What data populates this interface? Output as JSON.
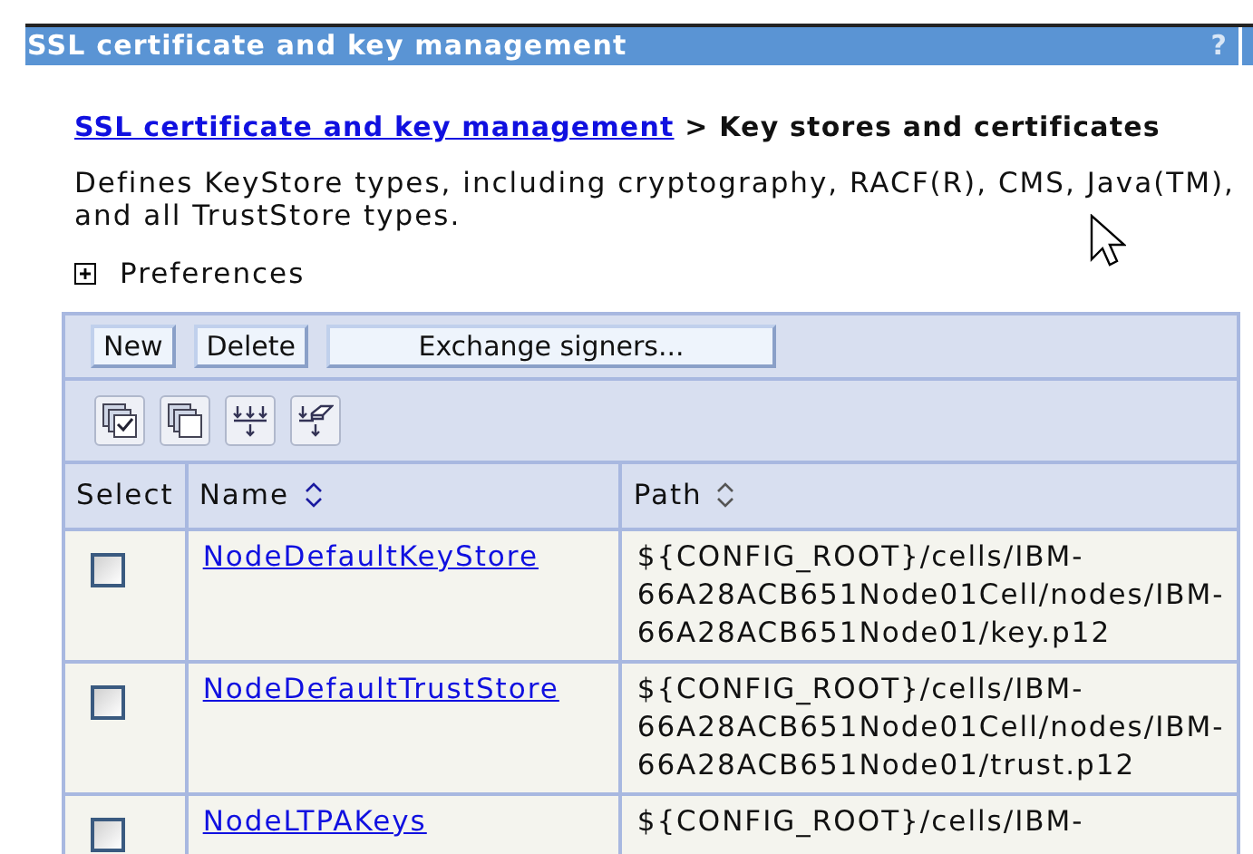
{
  "window": {
    "title": "SSL certificate and key management",
    "help": "?"
  },
  "breadcrumb": {
    "link": "SSL certificate and key management",
    "separator": ">",
    "current": "Key stores and certificates"
  },
  "description": "Defines KeyStore types, including cryptography, RACF(R), CMS, Java(TM), and all TrustStore types.",
  "preferences": {
    "label": "Preferences",
    "expanded": false
  },
  "buttons": [
    "New",
    "Delete",
    "Exchange signers..."
  ],
  "table": {
    "columns": [
      {
        "label": "Select",
        "sortable": false
      },
      {
        "label": "Name",
        "sortable": true
      },
      {
        "label": "Path",
        "sortable": true
      }
    ],
    "rows": [
      {
        "checked": false,
        "name": "NodeDefaultKeyStore",
        "path_lines": [
          "${CONFIG_ROOT}/cells/IBM-",
          "66A28ACB651Node01Cell/nodes/IBM-",
          "66A28ACB651Node01/key.p12"
        ]
      },
      {
        "checked": false,
        "name": "NodeDefaultTrustStore",
        "path_lines": [
          "${CONFIG_ROOT}/cells/IBM-",
          "66A28ACB651Node01Cell/nodes/IBM-",
          "66A28ACB651Node01/trust.p12"
        ]
      },
      {
        "checked": false,
        "name": "NodeLTPAKeys",
        "path_lines": [
          "${CONFIG_ROOT}/cells/IBM-"
        ]
      }
    ]
  }
}
